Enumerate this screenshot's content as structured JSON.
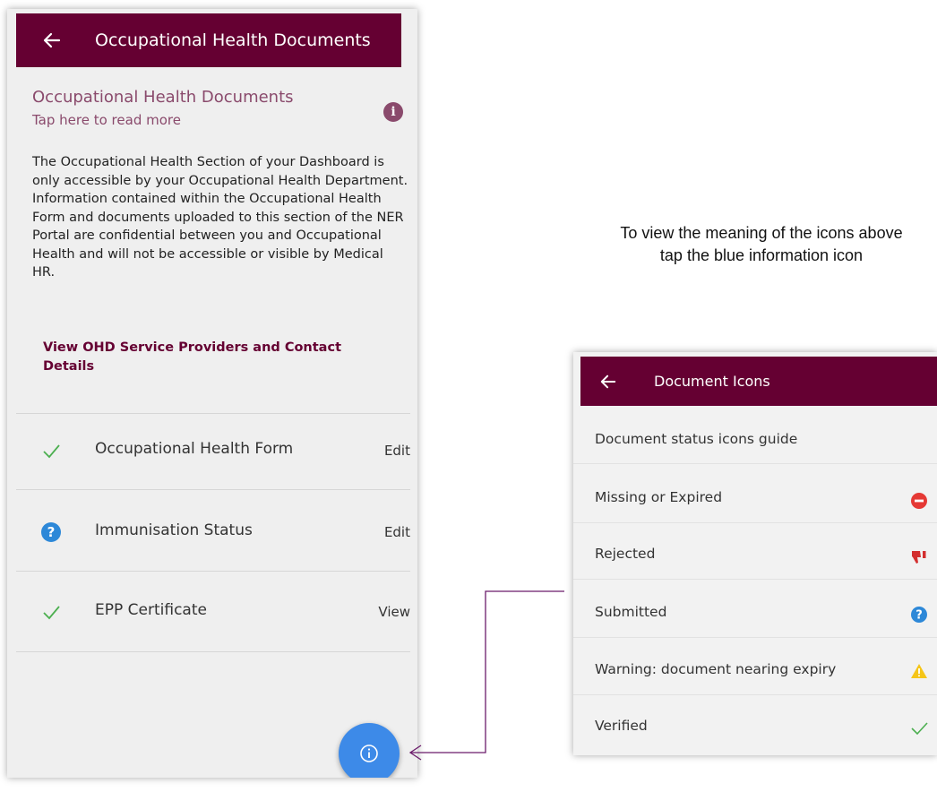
{
  "left_screen": {
    "appbar_title": "Occupational Health Documents",
    "heading": "Occupational Health Documents",
    "read_more": "Tap here to read more",
    "info_badge": "i",
    "description": "The Occupational Health Section of your Dashboard is only accessible by your Occupational Health Department. Information contained within the Occupational Health Form and documents uploaded to this section of the NER Portal are confidential between you and Occupational Health and will not be accessible or visible by Medical HR.",
    "ohd_link": "View OHD Service Providers and Contact Details",
    "documents": [
      {
        "label": "Occupational Health Form",
        "action": "Edit",
        "status_icon": "check-icon"
      },
      {
        "label": "Immunisation Status",
        "action": "Edit",
        "status_icon": "question-icon"
      },
      {
        "label": "EPP Certificate",
        "action": "View",
        "status_icon": "check-icon"
      }
    ],
    "fab_icon": "info-icon"
  },
  "caption": "To view the meaning of the icons above tap the blue information icon",
  "right_screen": {
    "appbar_title": "Document Icons",
    "guide_title": "Document status icons guide",
    "items": [
      {
        "label": "Missing or Expired",
        "icon": "minus-circle-icon"
      },
      {
        "label": "Rejected",
        "icon": "thumbs-down-icon"
      },
      {
        "label": "Submitted",
        "icon": "question-icon"
      },
      {
        "label": "Warning: document nearing expiry",
        "icon": "warning-icon"
      },
      {
        "label": "Verified",
        "icon": "check-icon"
      }
    ]
  },
  "colors": {
    "appbar": "#650032",
    "accent_text": "#8a4a6c",
    "fab": "#3d8ae8",
    "check": "#4caf50",
    "question": "#2d88d8",
    "missing": "#e53935",
    "rejected": "#d32f2f",
    "warning": "#f5c518",
    "connector": "#6a1b6a"
  }
}
